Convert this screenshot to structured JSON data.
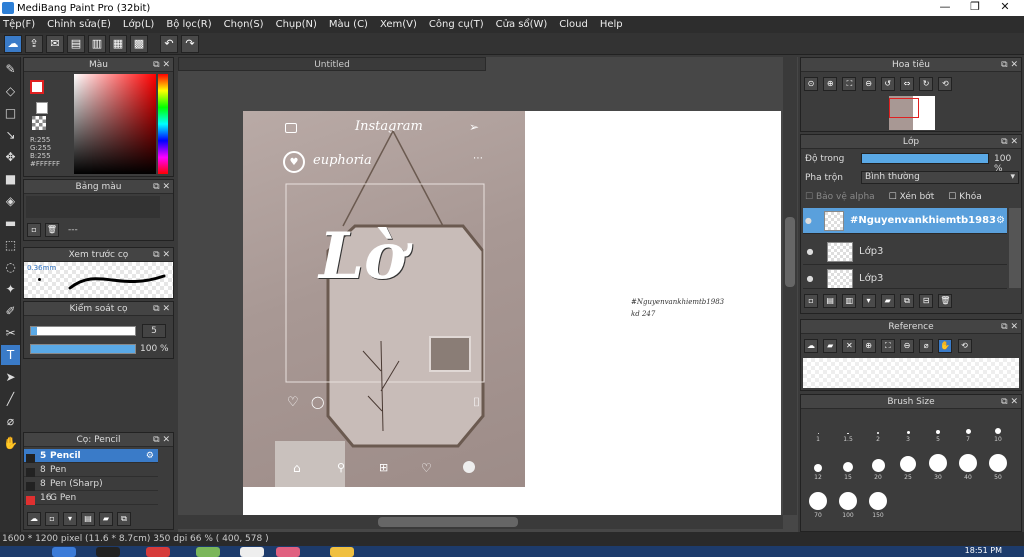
{
  "window": {
    "title": "MediBang Paint Pro (32bit)",
    "minimize": "—",
    "restore": "❐",
    "close": "✕"
  },
  "menu": [
    "Tệp(F)",
    "Chỉnh sửa(E)",
    "Lớp(L)",
    "Bộ lọc(R)",
    "Chọn(S)",
    "Chụp(N)",
    "Màu (C)",
    "Xem(V)",
    "Công cụ(T)",
    "Cửa sổ(W)",
    "Cloud",
    "Help"
  ],
  "color_panel": {
    "title": "Màu",
    "r": "R:255",
    "g": "G:255",
    "b": "B:255",
    "hex": "#FFFFFF",
    "accent": "#3a7bc8"
  },
  "palette_panel": {
    "title": "Bảng màu",
    "value": "---"
  },
  "preview_panel": {
    "title": "Xem trước cọ",
    "size": "0.36mm"
  },
  "control_panel": {
    "title": "Kiểm soát cọ",
    "size_value": "5",
    "opacity_value": "100 %",
    "opacity_level": 1.0
  },
  "brush_panel": {
    "title": "Cọ: Pencil",
    "items": [
      {
        "size": "5",
        "name": "Pencil",
        "selected": true,
        "color": "#222222"
      },
      {
        "size": "8",
        "name": "Pen",
        "selected": false,
        "color": "#222222"
      },
      {
        "size": "8",
        "name": "Pen (Sharp)",
        "selected": false,
        "color": "#222222"
      },
      {
        "size": "16",
        "name": "G Pen",
        "selected": false,
        "color": "#e03030"
      }
    ]
  },
  "document": {
    "tab": "Untitled",
    "photo_header": "Instagram",
    "photo_user": "euphoria",
    "photo_word": "Lờ",
    "sig_line1": "#Nguyenvankhiemtb1983",
    "sig_line2": "kd 247"
  },
  "navigator": {
    "title": "Hoa tiêu"
  },
  "layer_panel": {
    "title": "Lớp",
    "opacity_label": "Độ trong",
    "opacity_value": "100 %",
    "opacity_level": 1.0,
    "blend_label": "Pha trộn",
    "blend_value": "Bình thường",
    "protect_alpha": "Bảo vệ alpha",
    "clipping": "Xén bớt",
    "lock": "Khóa",
    "layers": [
      {
        "name": "#Nguyenvankhiemtb1983",
        "selected": true
      },
      {
        "name": "Lớp3",
        "selected": false
      },
      {
        "name": "Lớp3",
        "selected": false
      }
    ]
  },
  "reference_panel": {
    "title": "Reference"
  },
  "brushsize_panel": {
    "title": "Brush Size",
    "sizes": [
      "1",
      "1.5",
      "2",
      "3",
      "5",
      "7",
      "10",
      "12",
      "15",
      "20",
      "25",
      "30",
      "40",
      "50",
      "70",
      "100",
      "150"
    ]
  },
  "status": {
    "text": "1600 * 1200 pixel  (11.6 * 8.7cm)  350 dpi  66 %  ( 400, 578 )"
  },
  "taskbar": {
    "clock": "18:51 PM"
  }
}
